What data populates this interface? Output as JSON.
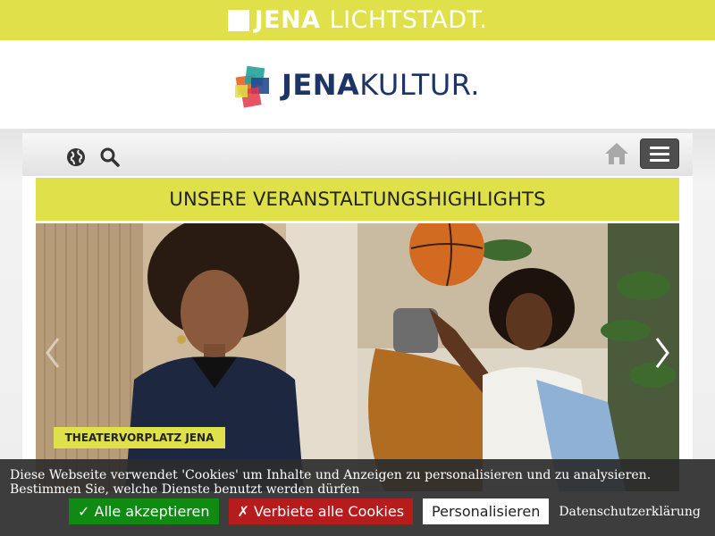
{
  "topbar": {
    "brand_bold": "JENA",
    "brand_light": "LICHTSTADT."
  },
  "logo": {
    "text_bold": "JENA",
    "text_light": "KULTUR."
  },
  "nav": {
    "globe_icon": "globe-icon",
    "search_icon": "search-icon",
    "home_icon": "home-icon",
    "menu_icon": "hamburger-menu-icon"
  },
  "main": {
    "heading": "UNSERE VERANSTALTUNGSHIGHLIGHTS",
    "venue_label": "THEATERVORPLATZ JENA"
  },
  "cookie": {
    "text": "Diese Webseite verwendet 'Cookies' um Inhalte und Anzeigen zu personalisieren und zu analysieren. Bestimmen Sie, welche Dienste benutzt werden dürfen",
    "accept_label": "✓ Alle akzeptieren",
    "deny_label": "✗ Verbiete alle Cookies",
    "customize_label": "Personalisieren",
    "privacy_label": "Datenschutzerklärung"
  },
  "colors": {
    "accent_yellow": "#dfe04a",
    "brand_navy": "#1d3565",
    "accept_green": "#0f8a12",
    "deny_red": "#b71c1c"
  }
}
